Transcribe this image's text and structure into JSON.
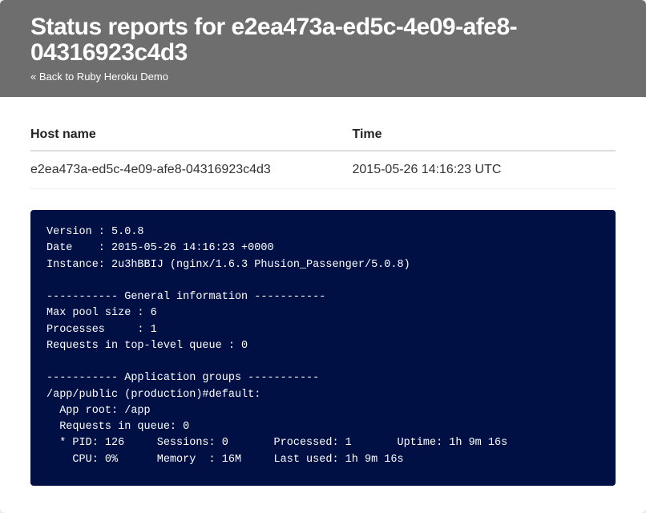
{
  "header": {
    "title": "Status reports for e2ea473a-ed5c-4e09-afe8-04316923c4d3",
    "back_link": "« Back to Ruby Heroku Demo"
  },
  "table": {
    "headers": {
      "hostname": "Host name",
      "time": "Time"
    },
    "row": {
      "hostname": "e2ea473a-ed5c-4e09-afe8-04316923c4d3",
      "time": "2015-05-26 14:16:23 UTC"
    }
  },
  "terminal": "Version : 5.0.8\nDate    : 2015-05-26 14:16:23 +0000\nInstance: 2u3hBBIJ (nginx/1.6.3 Phusion_Passenger/5.0.8)\n\n----------- General information -----------\nMax pool size : 6\nProcesses     : 1\nRequests in top-level queue : 0\n\n----------- Application groups -----------\n/app/public (production)#default:\n  App root: /app\n  Requests in queue: 0\n  * PID: 126     Sessions: 0       Processed: 1       Uptime: 1h 9m 16s\n    CPU: 0%      Memory  : 16M     Last used: 1h 9m 16s"
}
